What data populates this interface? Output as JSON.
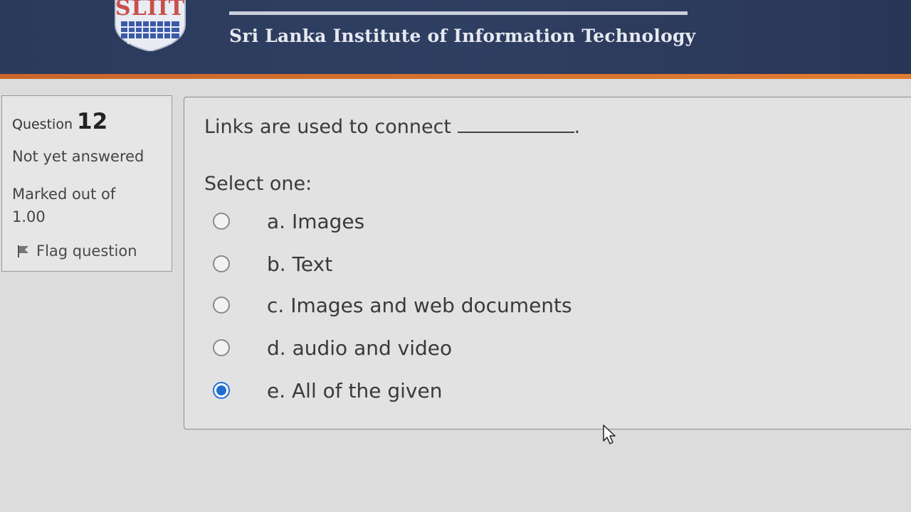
{
  "header": {
    "logo_text": "SLIIT",
    "institute_name": "Sri Lanka Institute of Information Technology",
    "colors": {
      "background": "#2b3a5c",
      "accent_stripe": "#e07c30"
    }
  },
  "question_info": {
    "question_label": "Question",
    "question_number": "12",
    "state": "Not yet answered",
    "marks_label": "Marked out of",
    "marks_value": "1.00",
    "flag_label": "Flag question",
    "flag_icon": "flag-icon"
  },
  "question": {
    "text": "Links are used to connect",
    "text_end": ".",
    "prompt": "Select one:",
    "options": [
      {
        "label": "a. Images",
        "selected": false
      },
      {
        "label": "b. Text",
        "selected": false
      },
      {
        "label": "c. Images and web documents",
        "selected": false
      },
      {
        "label": "d. audio and video",
        "selected": false
      },
      {
        "label": "e. All of the given",
        "selected": true
      }
    ],
    "selected_color": "#1f6fd1"
  }
}
